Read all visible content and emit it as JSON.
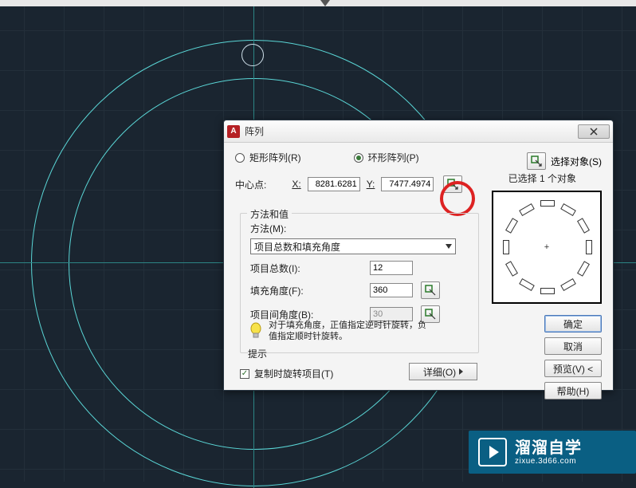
{
  "dialog": {
    "title": "阵列",
    "array_type": {
      "rect_label": "矩形阵列(R)",
      "polar_label": "环形阵列(P)"
    },
    "select_objects": {
      "label": "选择对象(S)",
      "status_prefix": "已选择",
      "count": "1",
      "status_suffix": "个对象"
    },
    "center": {
      "label": "中心点:",
      "x_label": "X:",
      "x_value": "8281.6281",
      "y_label": "Y:",
      "y_value": "7477.4974"
    },
    "method": {
      "legend": "方法和值",
      "label": "方法(M):",
      "combo_value": "项目总数和填充角度"
    },
    "params": {
      "total_label": "项目总数(I):",
      "total_value": "12",
      "fill_label": "填充角度(F):",
      "fill_value": "360",
      "between_label": "项目间角度(B):",
      "between_value": "30"
    },
    "hint": {
      "line1": "对于填充角度，正值指定逆时针旋转，负",
      "line2": "值指定顺时针旋转。",
      "caption": "提示"
    },
    "copy_rotate": {
      "label": "复制时旋转项目(T)"
    },
    "details_btn": "详细(O)",
    "buttons": {
      "ok": "确定",
      "cancel": "取消",
      "preview": "预览(V) <",
      "help": "帮助(H)"
    }
  },
  "watermark": {
    "brand": "溜溜自学",
    "url": "zixue.3d66.com"
  }
}
